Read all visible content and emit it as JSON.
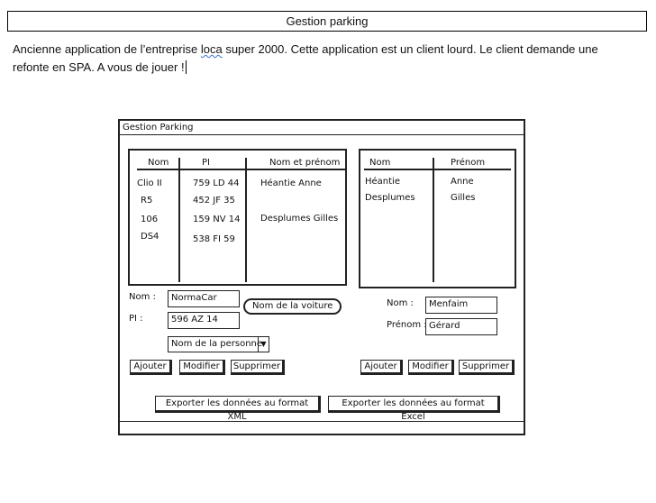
{
  "document": {
    "title": "Gestion parking",
    "text_part1": "Ancienne application de l’entreprise ",
    "text_loca": "loca",
    "text_part2": " super 2000. Cette application est un client lourd. Le client demande une",
    "text_line2": "refonte en SPA. A vous de jouer !"
  },
  "wireframe": {
    "window_title": "Gestion Parking",
    "cars_table": {
      "columns": [
        "Nom",
        "PI",
        "Nom et prénom"
      ],
      "rows": [
        [
          "Clio II",
          "759 LD 44",
          "Héantie Anne"
        ],
        [
          "R5",
          "452 JF 35",
          ""
        ],
        [
          "106",
          "159 NV 14",
          "Desplumes Gilles"
        ],
        [
          "DS4",
          "538 FI 59",
          ""
        ]
      ]
    },
    "people_table": {
      "columns": [
        "Nom",
        "Prénom"
      ],
      "rows": [
        [
          "Héantie",
          "Anne"
        ],
        [
          "Desplumes",
          "Gilles"
        ]
      ]
    },
    "car_form": {
      "nom_label": "Nom :",
      "nom_value": "NormaCar",
      "pi_label": "PI :",
      "pi_value": "596 AZ 14",
      "person_select": "Nom de la personne",
      "tooltip": "Nom de la voiture"
    },
    "person_form": {
      "nom_label": "Nom :",
      "nom_value": "Menfaim",
      "prenom_label": "Prénom :",
      "prenom_value": "Gérard"
    },
    "buttons": {
      "add": "Ajouter",
      "edit": "Modifier",
      "delete": "Supprimer",
      "export_xml": "Exporter les données au format XML",
      "export_excel": "Exporter les données au format Excel"
    }
  }
}
